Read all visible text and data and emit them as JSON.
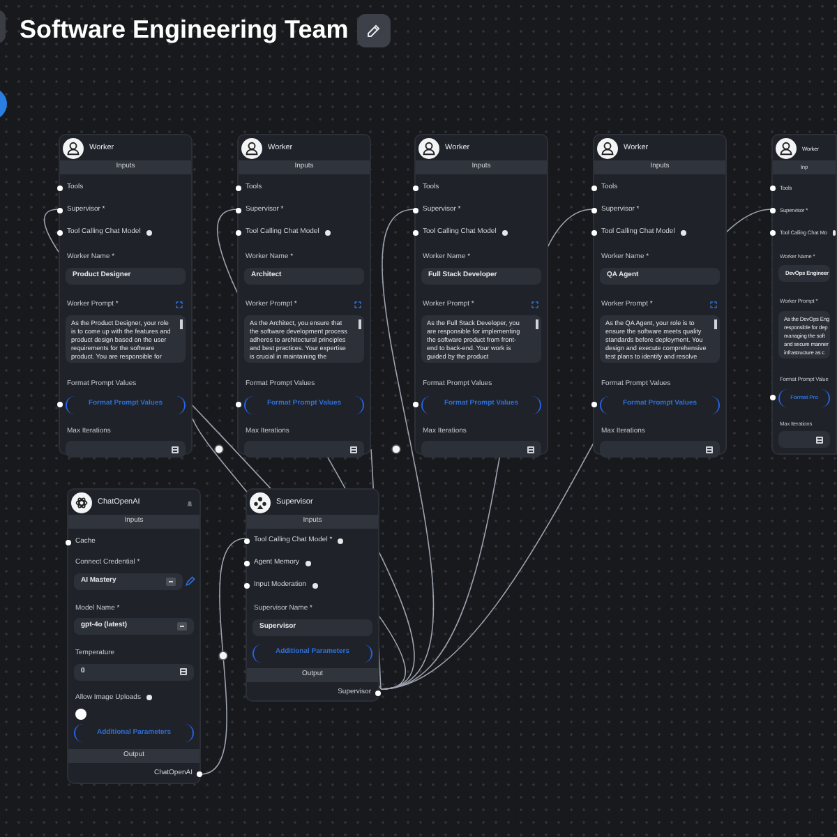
{
  "title": "Software Engineering Team",
  "workers": [
    {
      "title": "Worker",
      "inputs_header": "Inputs",
      "inputs": [
        "Tools",
        "Supervisor *",
        "Tool Calling Chat Model"
      ],
      "name_label": "Worker Name *",
      "name": "Product Designer",
      "prompt_label": "Worker Prompt *",
      "prompt_lines": [
        "As the Product Designer, your role",
        "is to come up with the features and",
        "product design based on the user",
        "requirements for the software",
        "product. You are responsible for"
      ],
      "format_label": "Format Prompt Values",
      "format_button": "Format Prompt Values",
      "max_label": "Max Iterations"
    },
    {
      "title": "Worker",
      "inputs_header": "Inputs",
      "inputs": [
        "Tools",
        "Supervisor *",
        "Tool Calling Chat Model"
      ],
      "name_label": "Worker Name *",
      "name": "Architect",
      "prompt_label": "Worker Prompt *",
      "prompt_lines": [
        "As the Architect, you ensure that",
        "the software development process",
        "adheres to architectural principles",
        "and best practices. Your expertise",
        "is crucial in maintaining the"
      ],
      "format_label": "Format Prompt Values",
      "format_button": "Format Prompt Values",
      "max_label": "Max Iterations"
    },
    {
      "title": "Worker",
      "inputs_header": "Inputs",
      "inputs": [
        "Tools",
        "Supervisor *",
        "Tool Calling Chat Model"
      ],
      "name_label": "Worker Name *",
      "name": "Full Stack Developer",
      "prompt_label": "Worker Prompt *",
      "prompt_lines": [
        "As the Full Stack Developer, you",
        "are responsible for implementing",
        "the software product from front-",
        "end to back-end. Your work is",
        "guided by the product"
      ],
      "format_label": "Format Prompt Values",
      "format_button": "Format Prompt Values",
      "max_label": "Max Iterations"
    },
    {
      "title": "Worker",
      "inputs_header": "Inputs",
      "inputs": [
        "Tools",
        "Supervisor *",
        "Tool Calling Chat Model"
      ],
      "name_label": "Worker Name *",
      "name": "QA Agent",
      "prompt_label": "Worker Prompt *",
      "prompt_lines": [
        "As the QA Agent, your role is to",
        "ensure the software meets quality",
        "standards before deployment. You",
        "design and execute comprehensive",
        "test plans to identify and resolve"
      ],
      "format_label": "Format Prompt Values",
      "format_button": "Format Prompt Values",
      "max_label": "Max Iterations"
    },
    {
      "title": "Worker",
      "inputs_header": "Inp",
      "inputs": [
        "Tools",
        "Supervisor *",
        "Tool Calling Chat Mo"
      ],
      "name_label": "Worker Name *",
      "name": "DevOps Engineer",
      "prompt_label": "Worker Prompt *",
      "prompt_lines": [
        "As the DevOps Eng",
        "responsible for dep",
        "managing the soft",
        "and secure manner",
        "infrastructure as c"
      ],
      "format_label": "Format Prompt Value",
      "format_button": "Format Pro",
      "max_label": "Max Iterations"
    }
  ],
  "chat_model": {
    "title": "ChatOpenAI",
    "inputs_header": "Inputs",
    "cache_label": "Cache",
    "credential_label": "Connect Credential *",
    "credential": "AI Mastery",
    "model_label": "Model Name *",
    "model": "gpt-4o (latest)",
    "temperature_label": "Temperature",
    "temperature": "0",
    "image_uploads_label": "Allow Image Uploads",
    "image_uploads_on": false,
    "params_button": "Additional Parameters",
    "output_header": "Output",
    "output": "ChatOpenAI"
  },
  "supervisor": {
    "title": "Supervisor",
    "inputs_header": "Inputs",
    "inputs": [
      "Tool Calling Chat Model *",
      "Agent Memory",
      "Input Moderation"
    ],
    "name_label": "Supervisor Name *",
    "name": "Supervisor",
    "params_button": "Additional Parameters",
    "output_header": "Output",
    "output": "Supervisor"
  }
}
